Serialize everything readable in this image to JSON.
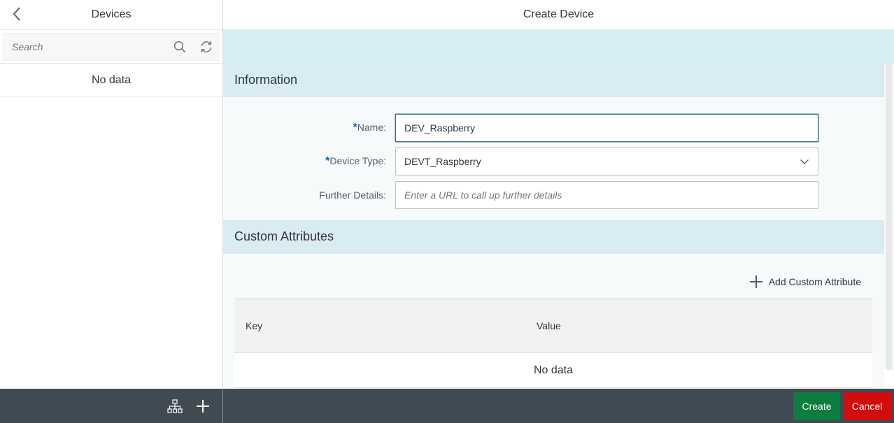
{
  "master": {
    "title": "Devices",
    "search_placeholder": "Search",
    "no_data": "No data"
  },
  "detail": {
    "title": "Create Device",
    "information": {
      "section_title": "Information",
      "name_label": "Name:",
      "name_value": "DEV_Raspberry",
      "device_type_label": "Device Type:",
      "device_type_value": "DEVT_Raspberry",
      "further_details_label": "Further Details:",
      "further_details_placeholder": "Enter a URL to call up further details"
    },
    "custom_attributes": {
      "section_title": "Custom Attributes",
      "add_label": "Add Custom Attribute",
      "columns": [
        "Key",
        "Value"
      ],
      "no_data": "No data"
    }
  },
  "footer": {
    "create_label": "Create",
    "cancel_label": "Cancel"
  },
  "required_marker": "*",
  "colors": {
    "teal_band": "#d5eef1",
    "footer_bar": "#3f4a52",
    "create_button": "#0d7d3d",
    "cancel_button": "#cf0d0d",
    "required_marker": "#1a5ea9"
  },
  "icons": [
    "back-chevron-icon",
    "search-icon",
    "refresh-icon",
    "hierarchy-icon",
    "plus-icon",
    "chevron-down-icon"
  ]
}
